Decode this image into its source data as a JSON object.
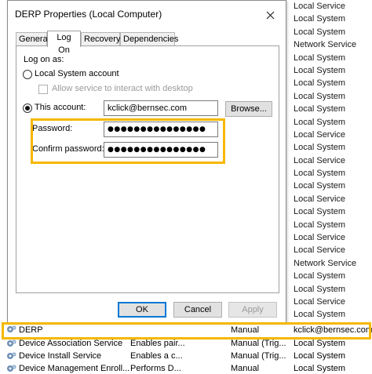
{
  "dialog": {
    "title": "DERP Properties (Local Computer)",
    "tabs": [
      {
        "label": "General",
        "active": false
      },
      {
        "label": "Log On",
        "active": true
      },
      {
        "label": "Recovery",
        "active": false
      },
      {
        "label": "Dependencies",
        "active": false
      }
    ],
    "logon_as_label": "Log on as:",
    "local_system_label": "Local System account",
    "allow_interact_label": "Allow service to interact with desktop",
    "this_account_label": "This account:",
    "account_value": "kclick@bernsec.com",
    "browse_label": "Browse...",
    "password_label": "Password:",
    "password_value": "●●●●●●●●●●●●●●●",
    "confirm_label": "Confirm password:",
    "confirm_value": "●●●●●●●●●●●●●●●",
    "ok_label": "OK",
    "cancel_label": "Cancel",
    "apply_label": "Apply",
    "selected_option": "This account",
    "highlight_color": "#f5b800"
  },
  "background_logon_column": [
    "Local Service",
    "Local System",
    "Local System",
    "Network Service",
    "Local System",
    "Local System",
    "Local System",
    "Local System",
    "Local System",
    "Local System",
    "Local Service",
    "Local System",
    "Local Service",
    "Local System",
    "Local System",
    "Local Service",
    "Local System",
    "Local System",
    "Local Service",
    "Local Service",
    "Network Service",
    "Local System",
    "Local System",
    "Local Service",
    "Local System"
  ],
  "service_rows": [
    {
      "name": "DERP",
      "description": "",
      "startup": "Manual",
      "logon": "kclick@bernsec.com"
    },
    {
      "name": "Device Association Service",
      "description": "Enables pair...",
      "startup": "Manual (Trig...",
      "logon": "Local System"
    },
    {
      "name": "Device Install Service",
      "description": "Enables a c...",
      "startup": "Manual (Trig...",
      "logon": "Local System"
    },
    {
      "name": "Device Management Enroll...",
      "description": "Performs D...",
      "startup": "Manual",
      "logon": "Local System"
    }
  ]
}
